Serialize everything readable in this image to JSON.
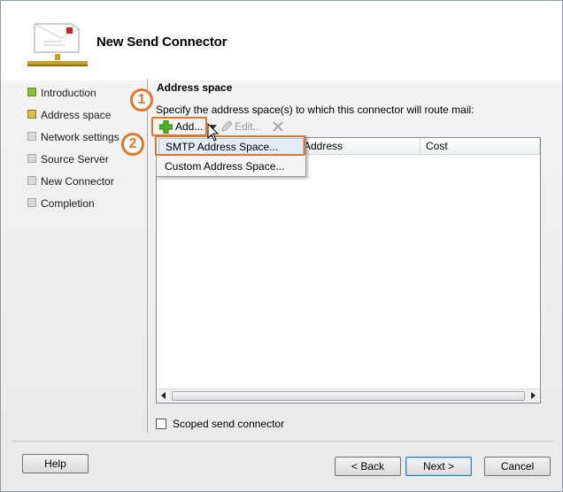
{
  "window": {
    "title": "New Send Connector"
  },
  "nav": {
    "items": [
      {
        "label": "Introduction",
        "state": "completed"
      },
      {
        "label": "Address space",
        "state": "current"
      },
      {
        "label": "Network settings",
        "state": "pending"
      },
      {
        "label": "Source Server",
        "state": "pending"
      },
      {
        "label": "New Connector",
        "state": "pending"
      },
      {
        "label": "Completion",
        "state": "pending"
      }
    ]
  },
  "main": {
    "section_title": "Address space",
    "instruction": "Specify the address space(s) to which this connector will route mail:",
    "toolbar": {
      "add_label": "Add...",
      "edit_label": "Edit...",
      "remove_icon": "remove-x-icon"
    },
    "list": {
      "columns": [
        "Address",
        "Cost"
      ],
      "rows": []
    },
    "add_menu": {
      "items": [
        "SMTP Address Space...",
        "Custom Address Space..."
      ],
      "highlighted": "SMTP Address Space..."
    },
    "scoped_checkbox": {
      "label": "Scoped send connector",
      "checked": false
    }
  },
  "callouts": {
    "step1": "1",
    "step2": "2"
  },
  "footer": {
    "help_label": "Help",
    "back_label": "< Back",
    "next_label": "Next >",
    "cancel_label": "Cancel"
  },
  "colors": {
    "accent_callout": "#e2762b",
    "nav_completed": "#86c440",
    "nav_current": "#d8c04c",
    "nav_pending": "#d9d9d9"
  }
}
